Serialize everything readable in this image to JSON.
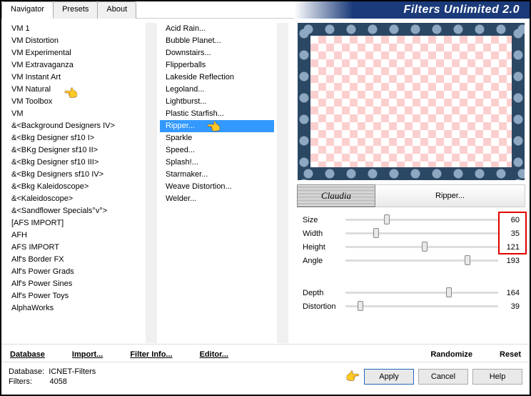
{
  "banner": "Filters Unlimited 2.0",
  "tabs": {
    "navigator": "Navigator",
    "presets": "Presets",
    "about": "About"
  },
  "categories": [
    "VM 1",
    "VM Distortion",
    "VM Experimental",
    "VM Extravaganza",
    "VM Instant Art",
    "VM Natural",
    "VM Toolbox",
    "VM",
    "&<Background Designers IV>",
    "&<Bkg Designer sf10 I>",
    "&<BKg Designer sf10 II>",
    "&<Bkg Designer sf10 III>",
    "&<Bkg Designers sf10 IV>",
    "&<Bkg Kaleidoscope>",
    "&<Kaleidoscope>",
    "&<Sandflower Specials°v°>",
    "[AFS IMPORT]",
    "AFH",
    "AFS IMPORT",
    "Alf's Border FX",
    "Alf's Power Grads",
    "Alf's Power Sines",
    "Alf's Power Toys",
    "AlphaWorks"
  ],
  "filters": [
    "Acid Rain...",
    "Bubble Planet...",
    "Downstairs...",
    "Flipperballs",
    "Lakeside Reflection",
    "Legoland...",
    "Lightburst...",
    "Plastic Starfish...",
    "Ripper...",
    "Sparkle",
    "Speed...",
    "Splash!...",
    "Starmaker...",
    "Weave Distortion...",
    "Welder..."
  ],
  "selected_category_idx": 5,
  "selected_filter_idx": 8,
  "logo_text": "Claudia",
  "filter_title": "Ripper...",
  "params": [
    {
      "label": "Size",
      "value": "60",
      "pos": 25
    },
    {
      "label": "Width",
      "value": "35",
      "pos": 18
    },
    {
      "label": "Height",
      "value": "121",
      "pos": 50
    },
    {
      "label": "Angle",
      "value": "193",
      "pos": 78
    }
  ],
  "params2": [
    {
      "label": "Depth",
      "value": "164",
      "pos": 66
    },
    {
      "label": "Distortion",
      "value": "39",
      "pos": 8
    }
  ],
  "links": {
    "database": "Database",
    "import": "Import...",
    "filterinfo": "Filter Info...",
    "editor": "Editor...",
    "randomize": "Randomize",
    "reset": "Reset"
  },
  "footer": {
    "db_label": "Database:",
    "db_value": "ICNET-Filters",
    "filters_label": "Filters:",
    "filters_value": "4058"
  },
  "buttons": {
    "apply": "Apply",
    "cancel": "Cancel",
    "help": "Help"
  }
}
